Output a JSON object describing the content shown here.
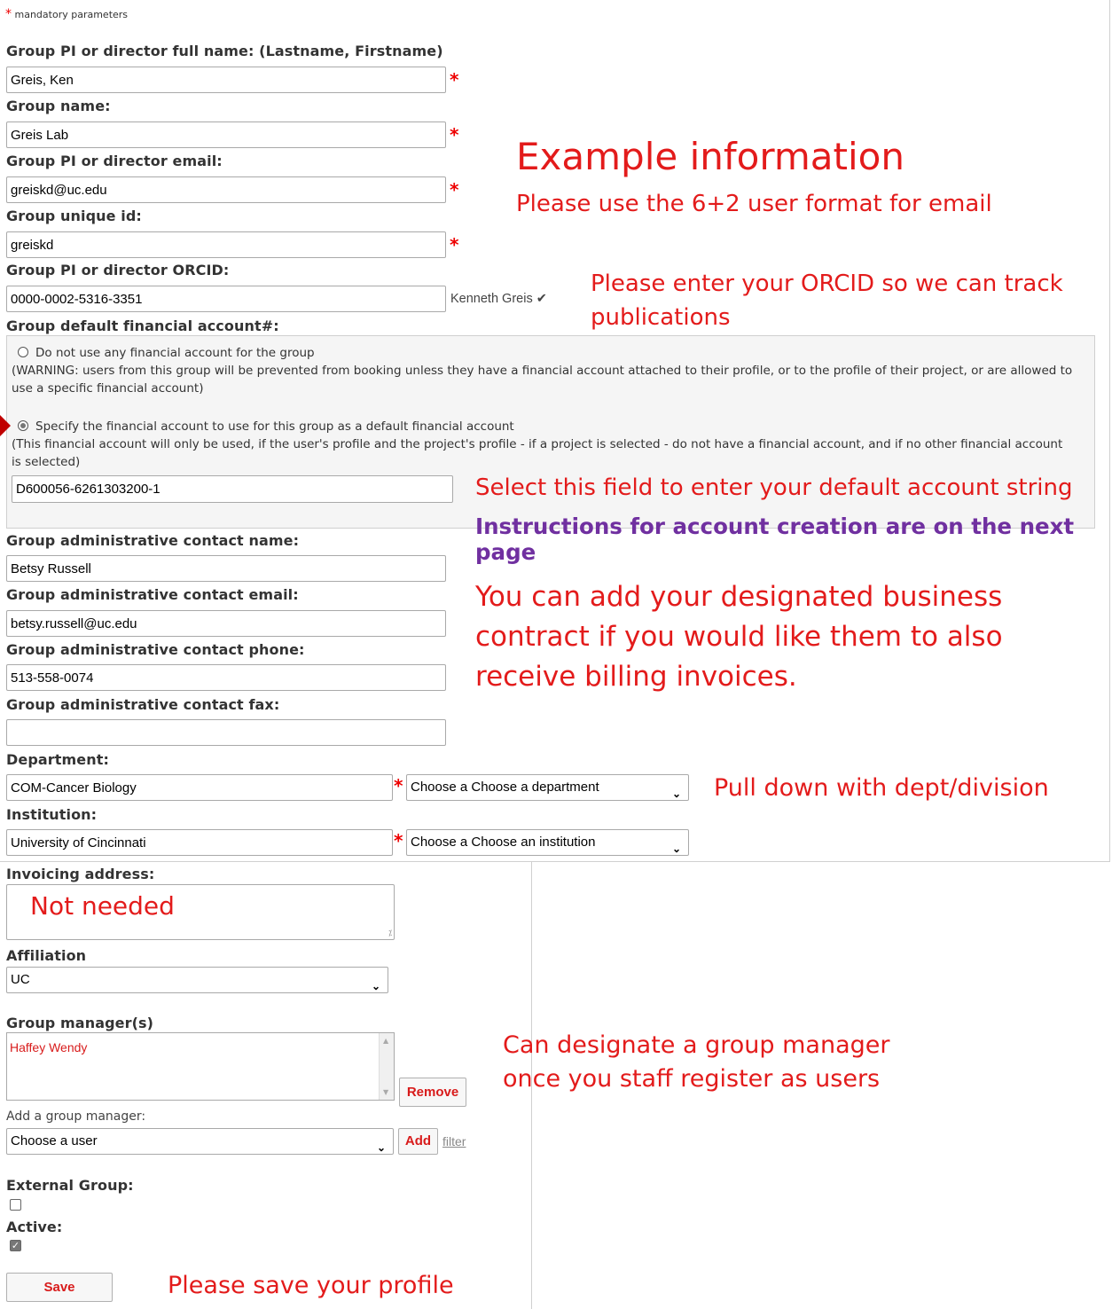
{
  "mandatory_note": "mandatory parameters",
  "fields": {
    "pi_name": {
      "label": "Group PI or director full name: (Lastname, Firstname)",
      "value": "Greis, Ken"
    },
    "group_name": {
      "label": "Group name:",
      "value": "Greis Lab"
    },
    "pi_email": {
      "label": "Group PI or director email:",
      "value": "greiskd@uc.edu"
    },
    "unique_id": {
      "label": "Group unique id:",
      "value": "greiskd"
    },
    "orcid": {
      "label": "Group PI or director ORCID:",
      "value": "0000-0002-5316-3351",
      "verified_name": "Kenneth Greis"
    },
    "financial": {
      "label": "Group default financial account#:",
      "opt1_label": "Do not use any financial account for the group",
      "opt1_note": "(WARNING: users from this group will be prevented from booking unless they have a financial account attached to their profile, or to the profile of their project, or are allowed to use a specific financial account)",
      "opt2_label": "Specify the financial account to use for this group as a default financial account",
      "opt2_note": "(This financial account will only be used, if the user's profile and the project's profile - if a project is selected - do not have a financial account, and if no other financial account is selected)",
      "account_value": "D600056-6261303200-1"
    },
    "admin_name": {
      "label": "Group administrative contact name:",
      "value": "Betsy Russell"
    },
    "admin_email": {
      "label": "Group administrative contact email:",
      "value": "betsy.russell@uc.edu"
    },
    "admin_phone": {
      "label": "Group administrative contact phone:",
      "value": "513-558-0074"
    },
    "admin_fax": {
      "label": "Group administrative contact fax:",
      "value": ""
    },
    "department": {
      "label": "Department:",
      "value": "COM-Cancer Biology",
      "select": "Choose a Choose a department"
    },
    "institution": {
      "label": "Institution:",
      "value": "University of Cincinnati",
      "select": "Choose a Choose an institution"
    },
    "invoicing": {
      "label": "Invoicing address:"
    },
    "affiliation": {
      "label": "Affiliation",
      "select": "UC"
    },
    "managers": {
      "label": "Group manager(s)",
      "items": [
        "Haffey Wendy"
      ],
      "remove_label": "Remove"
    },
    "add_manager": {
      "label": "Add a group manager:",
      "select": "Choose a user",
      "add_label": "Add",
      "filter_label": "filter"
    },
    "external": {
      "label": "External Group:",
      "checked": false
    },
    "active": {
      "label": "Active:",
      "checked": true
    },
    "save_label": "Save"
  },
  "annotations": {
    "example_title": "Example information",
    "email_note": "Please use the 6+2 user format for email",
    "orcid_note_1": "Please enter your ORCID so we can track",
    "orcid_note_2": "publications",
    "account_note": "Select this field to enter your default account string",
    "account_instr": "Instructions for account creation are on the next page",
    "business_1": "You can add your designated business",
    "business_2": "contract if you would like them to also",
    "business_3": "receive billing invoices.",
    "dept_note": "Pull down with dept/division",
    "not_needed": "Not needed",
    "manager_note_1": "Can designate a group manager",
    "manager_note_2": "once you staff register as users",
    "save_note": "Please save your profile"
  },
  "colors": {
    "annotation_red": "#e31b1b",
    "annotation_purple": "#7030a0",
    "required_star": "#ee0000"
  }
}
